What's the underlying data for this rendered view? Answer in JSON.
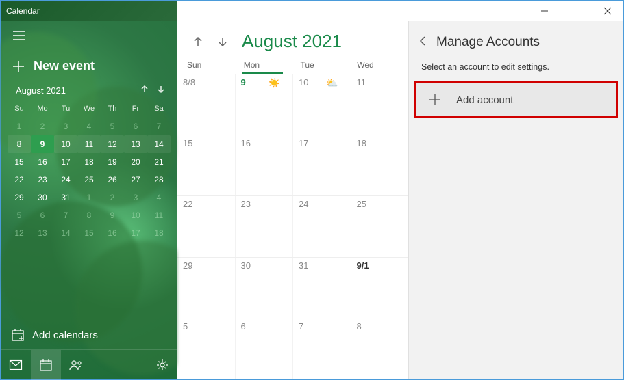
{
  "titlebar": {
    "app_name": "Calendar"
  },
  "sidebar": {
    "new_event_label": "New event",
    "mini": {
      "title": "August 2021",
      "dow": [
        "Su",
        "Mo",
        "Tu",
        "We",
        "Th",
        "Fr",
        "Sa"
      ],
      "rows": [
        [
          {
            "n": "1",
            "dim": true
          },
          {
            "n": "2",
            "dim": true
          },
          {
            "n": "3",
            "dim": true
          },
          {
            "n": "4",
            "dim": true
          },
          {
            "n": "5",
            "dim": true
          },
          {
            "n": "6",
            "dim": true
          },
          {
            "n": "7",
            "dim": true
          }
        ],
        [
          {
            "n": "8",
            "shade": true
          },
          {
            "n": "9",
            "today": true
          },
          {
            "n": "10",
            "shade": true
          },
          {
            "n": "11",
            "shade": true
          },
          {
            "n": "12",
            "shade": true
          },
          {
            "n": "13",
            "shade": true
          },
          {
            "n": "14",
            "shade": true
          }
        ],
        [
          {
            "n": "15"
          },
          {
            "n": "16"
          },
          {
            "n": "17"
          },
          {
            "n": "18"
          },
          {
            "n": "19"
          },
          {
            "n": "20"
          },
          {
            "n": "21"
          }
        ],
        [
          {
            "n": "22"
          },
          {
            "n": "23"
          },
          {
            "n": "24"
          },
          {
            "n": "25"
          },
          {
            "n": "26"
          },
          {
            "n": "27"
          },
          {
            "n": "28"
          }
        ],
        [
          {
            "n": "29"
          },
          {
            "n": "30"
          },
          {
            "n": "31"
          },
          {
            "n": "1",
            "dim": true
          },
          {
            "n": "2",
            "dim": true
          },
          {
            "n": "3",
            "dim": true
          },
          {
            "n": "4",
            "dim": true
          }
        ],
        [
          {
            "n": "5",
            "dim": true
          },
          {
            "n": "6",
            "dim": true
          },
          {
            "n": "7",
            "dim": true
          },
          {
            "n": "8",
            "dim": true
          },
          {
            "n": "9",
            "dim": true
          },
          {
            "n": "10",
            "dim": true
          },
          {
            "n": "11",
            "dim": true
          }
        ],
        [
          {
            "n": "12",
            "dim": true
          },
          {
            "n": "13",
            "dim": true
          },
          {
            "n": "14",
            "dim": true
          },
          {
            "n": "15",
            "dim": true
          },
          {
            "n": "16",
            "dim": true
          },
          {
            "n": "17",
            "dim": true
          },
          {
            "n": "18",
            "dim": true
          }
        ]
      ]
    },
    "add_calendars_label": "Add calendars"
  },
  "main": {
    "title": "August 2021",
    "dow": [
      "Sun",
      "Mon",
      "Tue",
      "Wed"
    ],
    "today_col_index": 1,
    "rows": [
      [
        {
          "label": "8/8"
        },
        {
          "label": "9",
          "today": true,
          "wx": "☀️"
        },
        {
          "label": "10",
          "wx": "⛅"
        },
        {
          "label": "11"
        }
      ],
      [
        {
          "label": "15"
        },
        {
          "label": "16"
        },
        {
          "label": "17"
        },
        {
          "label": "18"
        }
      ],
      [
        {
          "label": "22"
        },
        {
          "label": "23"
        },
        {
          "label": "24"
        },
        {
          "label": "25"
        }
      ],
      [
        {
          "label": "29"
        },
        {
          "label": "30"
        },
        {
          "label": "31"
        },
        {
          "label": "9/1",
          "monthstart": true
        }
      ],
      [
        {
          "label": "5"
        },
        {
          "label": "6"
        },
        {
          "label": "7"
        },
        {
          "label": "8"
        }
      ]
    ]
  },
  "panel": {
    "title": "Manage Accounts",
    "subtitle": "Select an account to edit settings.",
    "add_account_label": "Add account"
  }
}
